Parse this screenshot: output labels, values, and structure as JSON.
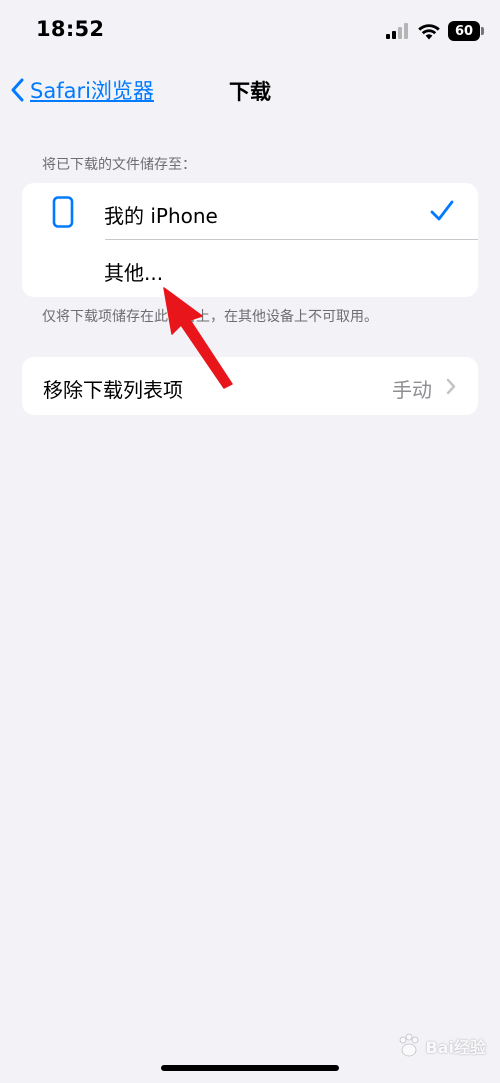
{
  "status_bar": {
    "time": "18:52",
    "battery": "60",
    "icons": [
      "signal-icon",
      "wifi-icon",
      "battery-icon"
    ]
  },
  "nav": {
    "back_label": "Safari浏览器",
    "title": "下载"
  },
  "storage_section": {
    "header": "将已下载的文件储存至：",
    "options": [
      {
        "label": "我的 iPhone",
        "icon": "iphone-icon",
        "selected": true
      },
      {
        "label": "其他..."
      }
    ],
    "footer": "仅将下载项储存在此设备上，在其他设备上不可取用。"
  },
  "remove_row": {
    "label": "移除下载列表项",
    "value": "手动"
  },
  "watermark": {
    "text": "Bai经验"
  },
  "colors": {
    "accent": "#007aff",
    "background": "#f2f2f7",
    "annotation": "#e8151b"
  }
}
